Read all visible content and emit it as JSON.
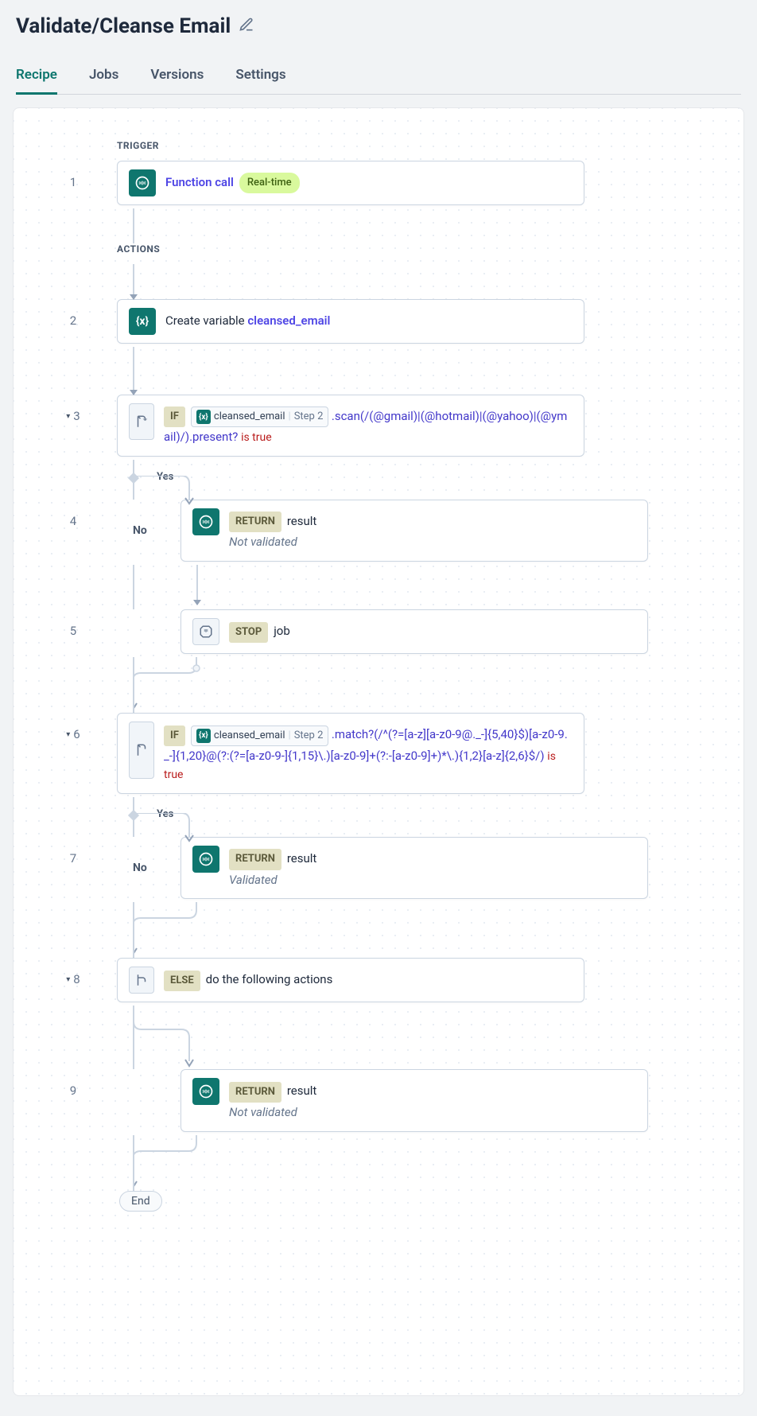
{
  "title": "Validate/Cleanse Email",
  "tabs": {
    "recipe": "Recipe",
    "jobs": "Jobs",
    "versions": "Versions",
    "settings": "Settings"
  },
  "sections": {
    "trigger": "TRIGGER",
    "actions": "ACTIONS"
  },
  "labels": {
    "yes": "Yes",
    "no": "No",
    "end": "End"
  },
  "pill": {
    "var_name": "cleansed_email",
    "step_ref": "Step 2"
  },
  "tags": {
    "if": "IF",
    "return": "RETURN",
    "stop": "STOP",
    "else": "ELSE"
  },
  "steps": {
    "s1": {
      "num": "1",
      "title": "Function call",
      "badge": "Real-time"
    },
    "s2": {
      "num": "2",
      "prefix": "Create variable ",
      "var": "cleansed_email"
    },
    "s3": {
      "num": "3",
      "formula_a": ".scan(/(@gmail)|(@hotmail)|(@yahoo)|(@ymail)/).present? ",
      "istrue": "is true"
    },
    "s4": {
      "num": "4",
      "result": "result",
      "sub": "Not validated"
    },
    "s5": {
      "num": "5",
      "text": "job"
    },
    "s6": {
      "num": "6",
      "formula_a": ".match?(/^(?=[a-z][a-z0-9@._-]{5,40}$)[a-z0-9._-]{1,20}@(?:(?=[a-z0-9-]{1,15}\\.)[a-z0-9]+(?:-[a-z0-9]+)*\\.){1,2}[a-z]{2,6}$/) ",
      "istrue": "is true"
    },
    "s7": {
      "num": "7",
      "result": "result",
      "sub": "Validated"
    },
    "s8": {
      "num": "8",
      "text": "do the following actions"
    },
    "s9": {
      "num": "9",
      "result": "result",
      "sub": "Not validated"
    }
  }
}
